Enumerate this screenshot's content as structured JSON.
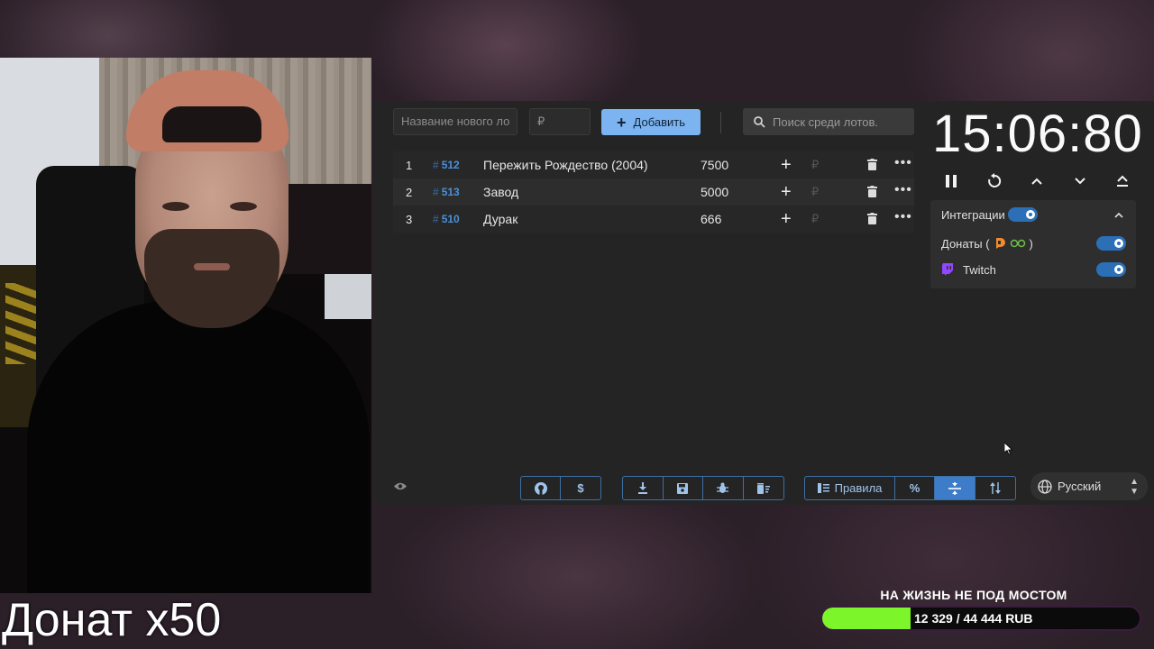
{
  "overlay": {
    "donation_multiplier": "Донат x50",
    "goal_title": "НА ЖИЗНЬ НЕ ПОД МОСТОМ",
    "goal_text": "12 329 / 44 444 RUB",
    "goal_progress": 0.277,
    "goal_color": "#7cf52a"
  },
  "toolbar": {
    "name_placeholder": "Название нового ло",
    "price_placeholder": "₽",
    "add_label": "Добавить",
    "search_placeholder": "Поиск среди лотов."
  },
  "lots": [
    {
      "index": "1",
      "id": "512",
      "name": "Пережить Рождество (2004)",
      "amount": "7500",
      "currency": "₽"
    },
    {
      "index": "2",
      "id": "513",
      "name": "Завод",
      "amount": "5000",
      "currency": "₽"
    },
    {
      "index": "3",
      "id": "510",
      "name": "Дурак",
      "amount": "666",
      "currency": "₽"
    }
  ],
  "timer": {
    "display": "15:06:80"
  },
  "integrations": {
    "title": "Интеграции",
    "donations_label": "Донаты (",
    "donations_close": ")",
    "twitch_label": "Twitch"
  },
  "bottom": {
    "rules_label": "Правила",
    "language": "Русский"
  },
  "colors": {
    "accent": "#7bb4f0",
    "lot_id": "#4a90d9",
    "toggle": "#2b6fb6",
    "twitch": "#9146ff"
  }
}
